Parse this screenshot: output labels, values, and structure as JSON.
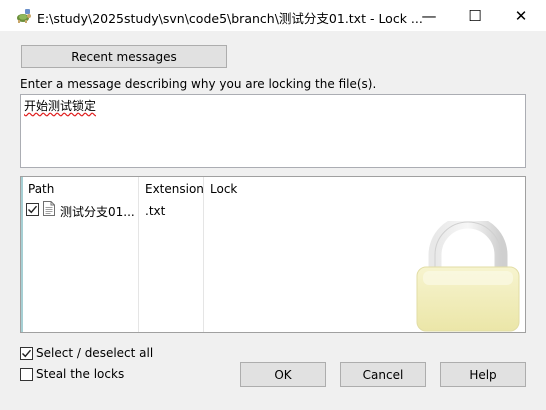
{
  "window": {
    "title": "E:\\study\\2025study\\svn\\code5\\branch\\测试分支01.txt - Lock ...",
    "minimize_glyph": "—",
    "maximize_glyph": "☐",
    "close_glyph": "✕"
  },
  "recent_messages_label": "Recent messages",
  "prompt": "Enter a message describing why you are locking the file(s).",
  "message": "开始测试锁定",
  "file_list": {
    "columns": [
      "Path",
      "Extension",
      "Lock"
    ],
    "rows": [
      {
        "name": "测试分支01...",
        "extension": ".txt",
        "lock": "",
        "checked": true
      }
    ]
  },
  "options": {
    "select_all_label": "Select / deselect all",
    "select_all_checked": true,
    "steal_label": "Steal the locks",
    "steal_checked": false
  },
  "buttons": {
    "ok": "OK",
    "cancel": "Cancel",
    "help": "Help"
  },
  "icons": {
    "app": "tortoise-icon",
    "row": "document-icon",
    "decoration": "padlock-icon"
  },
  "colors": {
    "lock_body": "#f2eec0",
    "lock_shackle": "#d8d8d8",
    "accent": "#4da0a8"
  }
}
